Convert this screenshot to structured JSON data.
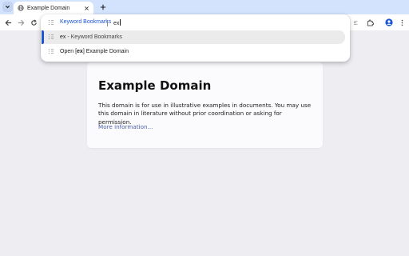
{
  "tab": {
    "title": "Example Domain"
  },
  "omnibox": {
    "keyword": "Keyword Bookmarks",
    "input_text": "ex",
    "suggestions": [
      {
        "keyword": "ex",
        "separator": " - ",
        "description": "Keyword Bookmarks",
        "selected": true
      },
      {
        "prefix": "Open [",
        "keyword": "ex",
        "suffix": "] Example Domain",
        "selected": false
      }
    ]
  },
  "page": {
    "heading": "Example Domain",
    "paragraph": "This domain is for use in illustrative examples in documents. You may use this domain in literature without prior coordination or asking for permission.",
    "link": "More information..."
  },
  "icons": {
    "tab_menu": "chevron-down-icon",
    "favicon": "globe-icon",
    "tab_close": "close-icon",
    "new_tab": "plus-icon",
    "back": "back-arrow-icon",
    "forward": "forward-arrow-icon",
    "reload": "reload-icon",
    "omnibox_keyword": "bookmark-search-icon",
    "suggestion": "bookmark-search-icon",
    "extensions": "puzzle-icon",
    "profile": "profile-icon",
    "menu": "kebab-menu-icon",
    "tab_search": "tab-search-icon"
  },
  "colors": {
    "tab_strip": "#d3e3fd",
    "accent": "#1a55d6",
    "page_background": "#eeedf2",
    "link": "#4a5fa8",
    "profile": "#1a55d6"
  }
}
